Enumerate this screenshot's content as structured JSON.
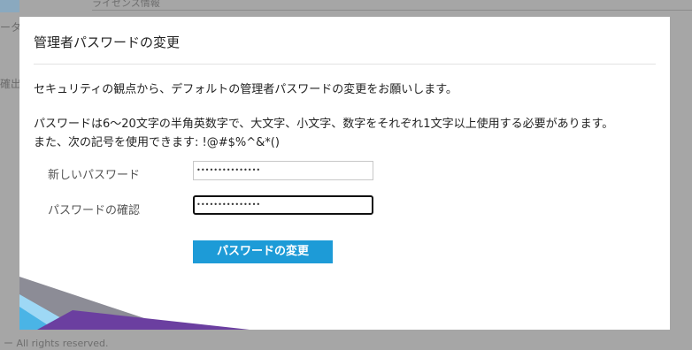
{
  "background": {
    "tab_label": "ライセンス情報",
    "left_fragment_1": "ータ",
    "left_fragment_2": "確出",
    "footer": "ー All rights reserved."
  },
  "modal": {
    "title": "管理者パスワードの変更",
    "intro": "セキュリティの観点から、デフォルトの管理者パスワードの変更をお願いします。",
    "rule_line1": "パスワードは6〜20文字の半角英数字で、大文字、小文字、数字をそれぞれ1文字以上使用する必要があります。",
    "rule_line2": "また、次の記号を使用できます: !@#$%^&*()",
    "new_password_label": "新しいパスワード",
    "new_password_value": "•••••••••••••••",
    "confirm_password_label": "パスワードの確認",
    "confirm_password_value": "•••••••••••••••",
    "submit_label": "パスワードの変更"
  },
  "colors": {
    "button": "#1d9bd7",
    "overlay": "#a6a6a6",
    "deco_purple": "#6b3fa0",
    "deco_blue": "#4ab4e6",
    "deco_lightblue": "#9ed8f5",
    "deco_gray": "#8c8c96"
  }
}
